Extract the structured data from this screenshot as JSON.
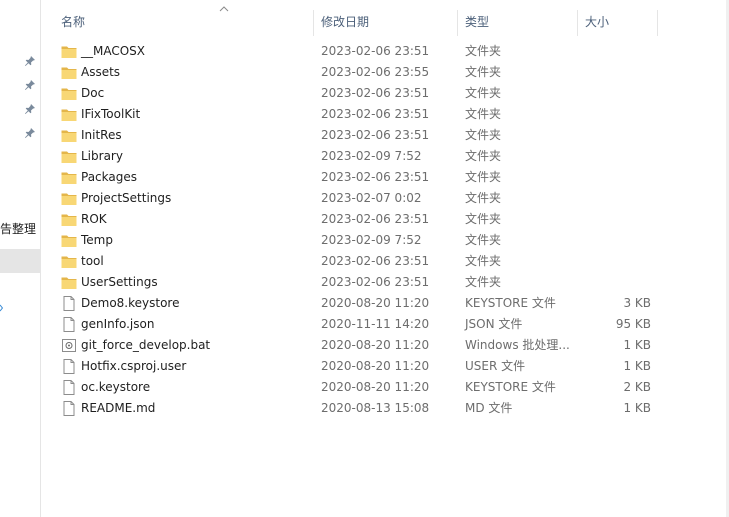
{
  "nav": {
    "quick_access_label": "告整理",
    "pins": [
      "pin-icon",
      "pin-icon",
      "pin-icon",
      "pin-icon"
    ]
  },
  "headers": {
    "name": "名称",
    "date": "修改日期",
    "type": "类型",
    "size": "大小"
  },
  "files": [
    {
      "name": "__MACOSX",
      "date": "2023-02-06 23:51",
      "type": "文件夹",
      "size": "",
      "icon": "folder-icon"
    },
    {
      "name": "Assets",
      "date": "2023-02-06 23:55",
      "type": "文件夹",
      "size": "",
      "icon": "folder-icon"
    },
    {
      "name": "Doc",
      "date": "2023-02-06 23:51",
      "type": "文件夹",
      "size": "",
      "icon": "folder-icon"
    },
    {
      "name": "IFixToolKit",
      "date": "2023-02-06 23:51",
      "type": "文件夹",
      "size": "",
      "icon": "folder-icon"
    },
    {
      "name": "InitRes",
      "date": "2023-02-06 23:51",
      "type": "文件夹",
      "size": "",
      "icon": "folder-icon"
    },
    {
      "name": "Library",
      "date": "2023-02-09 7:52",
      "type": "文件夹",
      "size": "",
      "icon": "folder-icon"
    },
    {
      "name": "Packages",
      "date": "2023-02-06 23:51",
      "type": "文件夹",
      "size": "",
      "icon": "folder-icon"
    },
    {
      "name": "ProjectSettings",
      "date": "2023-02-07 0:02",
      "type": "文件夹",
      "size": "",
      "icon": "folder-icon"
    },
    {
      "name": "ROK",
      "date": "2023-02-06 23:51",
      "type": "文件夹",
      "size": "",
      "icon": "folder-icon"
    },
    {
      "name": "Temp",
      "date": "2023-02-09 7:52",
      "type": "文件夹",
      "size": "",
      "icon": "folder-icon"
    },
    {
      "name": "tool",
      "date": "2023-02-06 23:51",
      "type": "文件夹",
      "size": "",
      "icon": "folder-icon"
    },
    {
      "name": "UserSettings",
      "date": "2023-02-06 23:51",
      "type": "文件夹",
      "size": "",
      "icon": "folder-icon"
    },
    {
      "name": "Demo8.keystore",
      "date": "2020-08-20 11:20",
      "type": "KEYSTORE 文件",
      "size": "3 KB",
      "icon": "file-icon"
    },
    {
      "name": "genInfo.json",
      "date": "2020-11-11 14:20",
      "type": "JSON 文件",
      "size": "95 KB",
      "icon": "file-icon"
    },
    {
      "name": "git_force_develop.bat",
      "date": "2020-08-20 11:20",
      "type": "Windows 批处理...",
      "size": "1 KB",
      "icon": "batch-file-icon"
    },
    {
      "name": "Hotfix.csproj.user",
      "date": "2020-08-20 11:20",
      "type": "USER 文件",
      "size": "1 KB",
      "icon": "file-icon"
    },
    {
      "name": "oc.keystore",
      "date": "2020-08-20 11:20",
      "type": "KEYSTORE 文件",
      "size": "2 KB",
      "icon": "file-icon"
    },
    {
      "name": "README.md",
      "date": "2020-08-13 15:08",
      "type": "MD 文件",
      "size": "1 KB",
      "icon": "file-icon"
    }
  ],
  "colors": {
    "folder": "#f8d775",
    "folder_dark": "#e4b64a",
    "header_text": "#4c607a",
    "meta_text": "#6d6d6d",
    "selection": "#e5e5e5"
  }
}
